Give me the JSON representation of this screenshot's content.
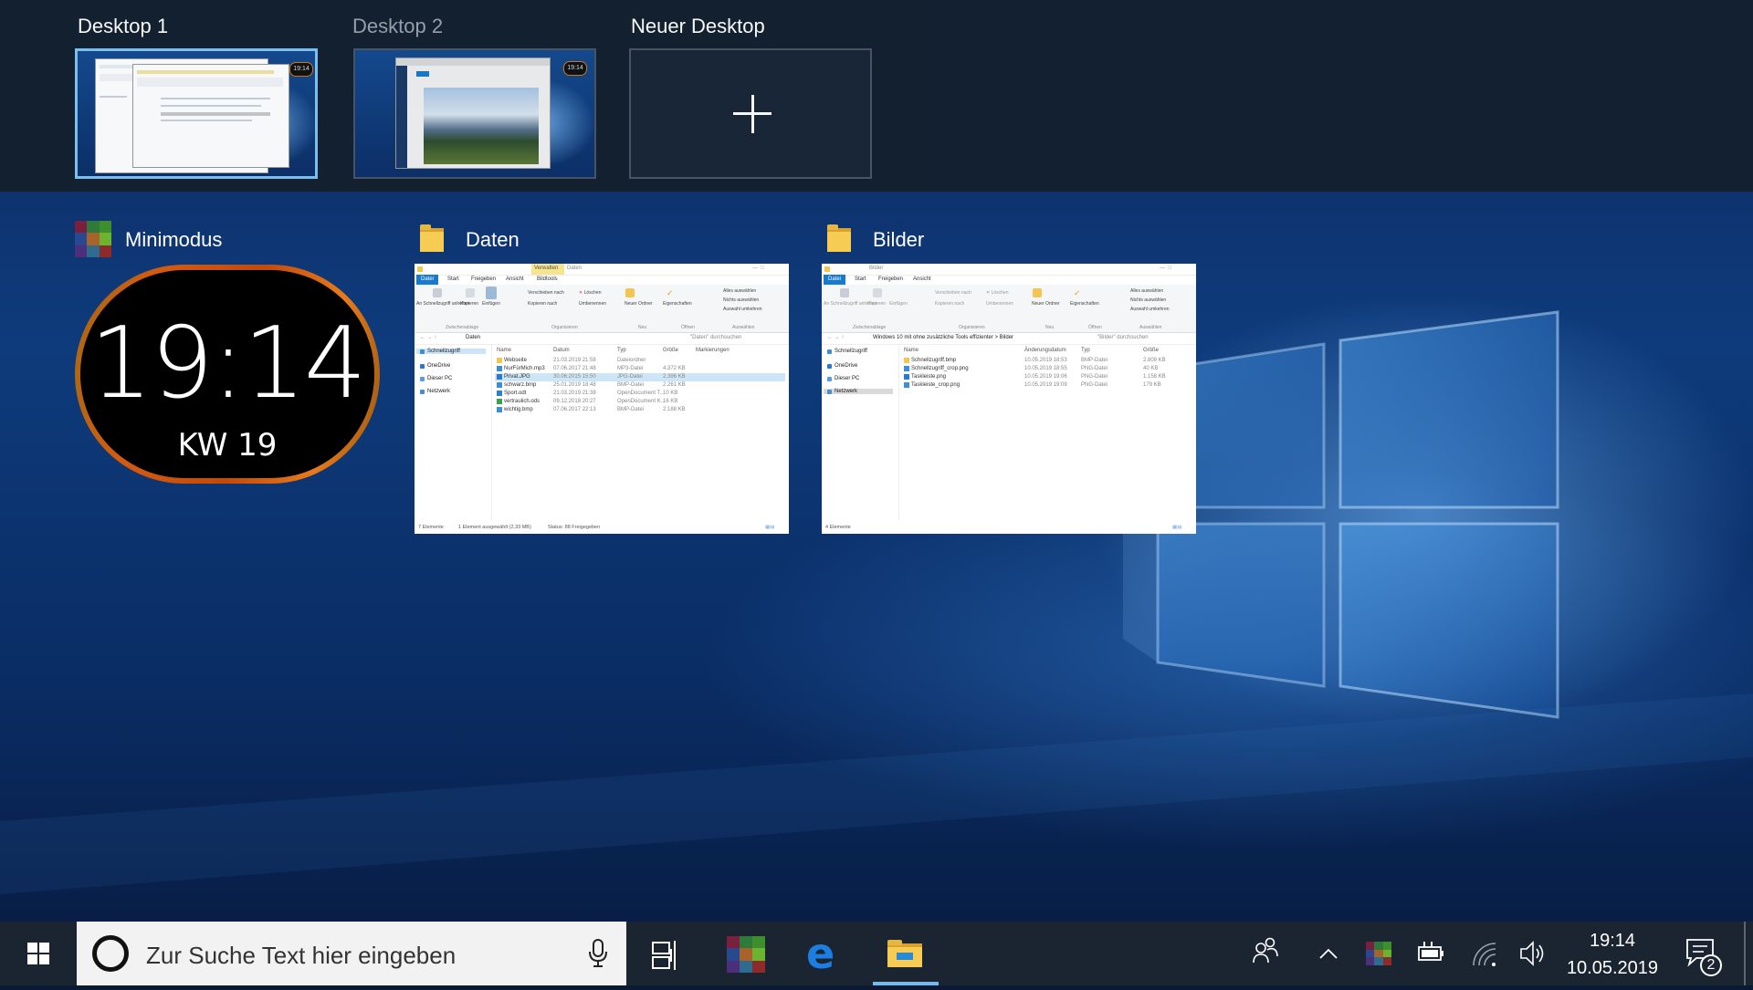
{
  "desktops": [
    {
      "label": "Desktop 1",
      "active": true
    },
    {
      "label": "Desktop 2",
      "active": false
    }
  ],
  "new_desktop": {
    "label": "Neuer Desktop"
  },
  "windows": {
    "minimodus": {
      "title": "Minimodus",
      "clock": {
        "time": "19:14",
        "week": "KW 19"
      }
    },
    "daten": {
      "title": "Daten",
      "title_bar": "Daten",
      "contextual_tab": "Verwalten",
      "tabs": [
        "Datei",
        "Start",
        "Freigeben",
        "Ansicht",
        "Bildtools"
      ],
      "ribbon": {
        "pin_label": "An Schnellzugriff anheften",
        "copy_label": "Kopieren",
        "paste_label": "Einfügen",
        "clipboard_group": "Zwischenablage",
        "move_to": "Verschieben nach",
        "copy_to": "Kopieren nach",
        "delete": "Löschen",
        "rename": "Umbenennen",
        "organize_group": "Organisieren",
        "new_folder": "Neuer Ordner",
        "new_group": "Neu",
        "properties": "Eigenschaften",
        "open_group": "Öffnen",
        "select_all": "Alles auswählen",
        "select_none": "Nichts auswählen",
        "invert_selection": "Auswahl umkehren",
        "select_group": "Auswählen"
      },
      "address": "Daten",
      "search_placeholder": "\"Daten\" durchsuchen",
      "nav": [
        "Schnellzugriff",
        "OneDrive",
        "Dieser PC",
        "Netzwerk"
      ],
      "columns": [
        "Name",
        "Datum",
        "Typ",
        "Größe",
        "Markierungen"
      ],
      "files": [
        {
          "name": "Webseite",
          "date": "21.03.2019 21:58",
          "type": "Dateiordner",
          "size": ""
        },
        {
          "name": "NurFürMich.mp3",
          "date": "07.06.2017 21:48",
          "type": "MP3-Datei",
          "size": "4.372 KB"
        },
        {
          "name": "Privat.JPG",
          "date": "30.06.2015 15:50",
          "type": "JPG-Datei",
          "size": "2.396 KB"
        },
        {
          "name": "schwarz.bmp",
          "date": "25.01.2019 18:48",
          "type": "BMP-Datei",
          "size": "2.261 KB"
        },
        {
          "name": "Sport.odt",
          "date": "21.03.2019 21:38",
          "type": "OpenDocument T...",
          "size": "10 KB"
        },
        {
          "name": "vertraulich.ods",
          "date": "09.12.2018 20:27",
          "type": "OpenDocument K...",
          "size": "16 KB"
        },
        {
          "name": "wichtig.bmp",
          "date": "07.06.2017 22:13",
          "type": "BMP-Datei",
          "size": "2.188 KB"
        }
      ],
      "status": {
        "count": "7 Elemente",
        "selection": "1 Element ausgewählt (2,33 MB)",
        "share": "Status: 88 Freigegeben"
      }
    },
    "bilder": {
      "title": "Bilder",
      "title_bar": "Bilder",
      "tabs": [
        "Datei",
        "Start",
        "Freigeben",
        "Ansicht"
      ],
      "address": "Windows 10 mit ohne zusätzliche Tools effizienter  >  Bilder",
      "search_placeholder": "\"Bilder\" durchsuchen",
      "nav": [
        "Schnellzugriff",
        "OneDrive",
        "Dieser PC",
        "Netzwerk"
      ],
      "columns": [
        "Name",
        "Änderungsdatum",
        "Typ",
        "Größe"
      ],
      "files": [
        {
          "name": "Schnellzugriff.bmp",
          "date": "10.05.2019 18:53",
          "type": "BMP-Datei",
          "size": "2.809 KB"
        },
        {
          "name": "Schnellzugriff_crop.png",
          "date": "10.05.2019 18:55",
          "type": "PNG-Datei",
          "size": "40 KB"
        },
        {
          "name": "Taskleiste.png",
          "date": "10.05.2019 19:06",
          "type": "PNG-Datei",
          "size": "1.158 KB"
        },
        {
          "name": "Taskleiste_crop.png",
          "date": "10.05.2019 19:09",
          "type": "PNG-Datei",
          "size": "179 KB"
        }
      ],
      "status": {
        "count": "4 Elemente"
      }
    }
  },
  "taskbar": {
    "search_placeholder": "Zur Suche Text hier eingeben",
    "pinned": [
      "minimodus-app-icon",
      "edge-icon",
      "file-explorer-icon"
    ],
    "tray": {
      "time": "19:14",
      "date": "10.05.2019",
      "notification_count": "2"
    }
  },
  "colors": {
    "accent": "#76b9ed",
    "taskbar": "#1b2532",
    "strip": "#14202f",
    "clock_ring": "#d55a10"
  }
}
